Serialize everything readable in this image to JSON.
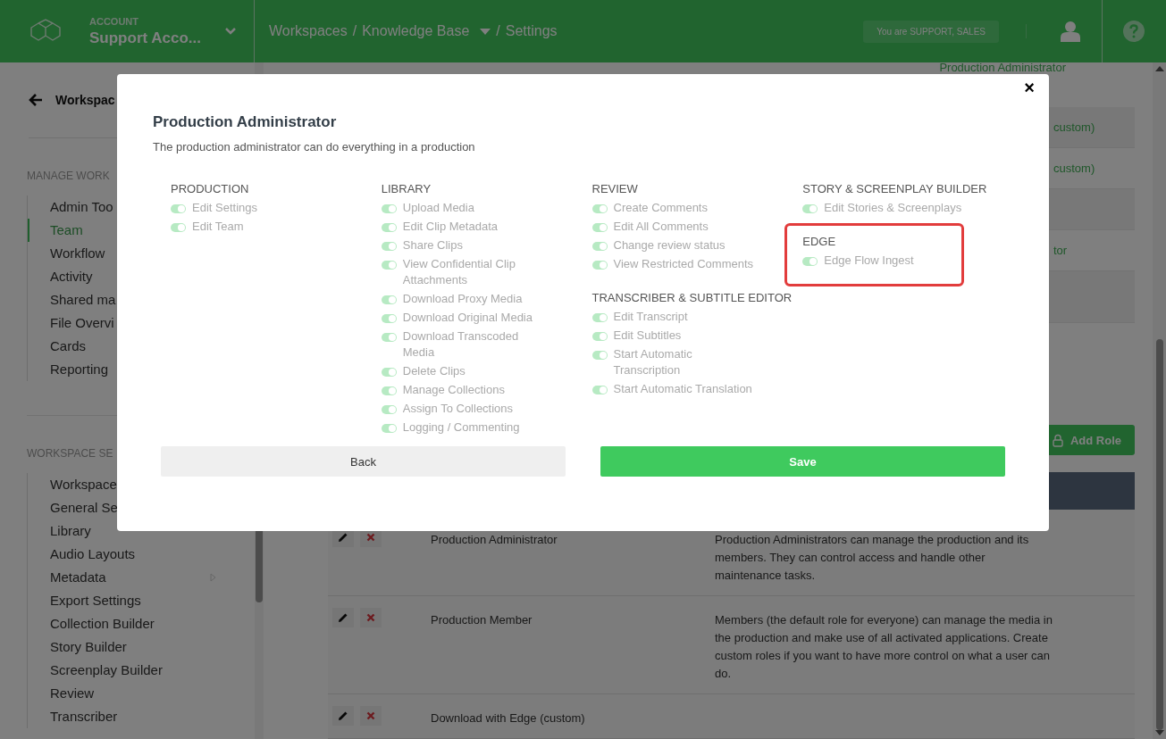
{
  "header": {
    "account_label": "ACCOUNT",
    "account_name": "Support Acco...",
    "breadcrumbs": [
      {
        "label": "Workspaces",
        "dropdown": false
      },
      {
        "label": "Knowledge Base",
        "dropdown": true
      },
      {
        "label": "Settings",
        "dropdown": false
      }
    ],
    "separator": "/",
    "role_badge": "You are SUPPORT, SALES"
  },
  "sidebar": {
    "back_label": "Workspac",
    "sections": [
      {
        "title": "MANAGE WORK",
        "items": [
          {
            "label": "Admin Too",
            "selected": false
          },
          {
            "label": "Team",
            "selected": true
          },
          {
            "label": "Workflow",
            "selected": false
          },
          {
            "label": "Activity",
            "selected": false
          },
          {
            "label": "Shared ma",
            "selected": false
          },
          {
            "label": "File Overvi",
            "selected": false
          },
          {
            "label": "Cards",
            "selected": false
          },
          {
            "label": "Reporting",
            "selected": false
          }
        ]
      },
      {
        "title": "WORKSPACE SE",
        "items": [
          {
            "label": "Workspace",
            "selected": false
          },
          {
            "label": "General Se",
            "selected": false
          },
          {
            "label": "Library",
            "selected": false
          },
          {
            "label": "Audio Layouts",
            "selected": false
          },
          {
            "label": "Metadata",
            "selected": false,
            "submenu": true
          },
          {
            "label": "Export Settings",
            "selected": false
          },
          {
            "label": "Collection Builder",
            "selected": false
          },
          {
            "label": "Story Builder",
            "selected": false
          },
          {
            "label": "Screenplay Builder",
            "selected": false
          },
          {
            "label": "Review",
            "selected": false
          },
          {
            "label": "Transcriber",
            "selected": false
          }
        ]
      }
    ]
  },
  "main": {
    "top_fragment": "Production Administrator",
    "role_rows": [
      {
        "fragment": "custom)"
      },
      {
        "fragment": "custom)"
      },
      {},
      {
        "fragment": "tor"
      },
      {}
    ],
    "add_role_button": "Add Role",
    "table_rows": [
      {
        "name": "Production Administrator",
        "description": "Production Administrators can manage the production and its members. They can control access and handle other maintenance tasks."
      },
      {
        "name": "Production Member",
        "description": "Members (the default role for everyone) can manage the media in the production and make use of all activated applications. Create custom roles if you want to have more control on what a user can do."
      },
      {
        "name": "Download with Edge (custom)"
      }
    ]
  },
  "modal": {
    "close": "×",
    "title": "Production Administrator",
    "description": "The production administrator can do everything in a production",
    "columns": [
      [
        {
          "title": "PRODUCTION",
          "highlighted": false,
          "permissions": [
            {
              "label": "Edit Settings",
              "on": true
            },
            {
              "label": "Edit Team",
              "on": true
            }
          ]
        }
      ],
      [
        {
          "title": "LIBRARY",
          "highlighted": false,
          "permissions": [
            {
              "label": "Upload Media",
              "on": true
            },
            {
              "label": "Edit Clip Metadata",
              "on": true
            },
            {
              "label": "Share Clips",
              "on": true
            },
            {
              "label": "View Confidential Clip Attachments",
              "on": true
            },
            {
              "label": "Download Proxy Media",
              "on": true
            },
            {
              "label": "Download Original Media",
              "on": true
            },
            {
              "label": "Download Transcoded Media",
              "on": true
            },
            {
              "label": "Delete Clips",
              "on": true
            },
            {
              "label": "Manage Collections",
              "on": true
            },
            {
              "label": "Assign To Collections",
              "on": true
            },
            {
              "label": "Logging / Commenting",
              "on": true
            }
          ]
        }
      ],
      [
        {
          "title": "REVIEW",
          "highlighted": false,
          "permissions": [
            {
              "label": "Create Comments",
              "on": true
            },
            {
              "label": "Edit All Comments",
              "on": true
            },
            {
              "label": "Change review status",
              "on": true
            },
            {
              "label": "View Restricted Comments",
              "on": true
            }
          ]
        },
        {
          "title": "TRANSCRIBER & SUBTITLE EDITOR",
          "highlighted": false,
          "permissions": [
            {
              "label": "Edit Transcript",
              "on": true
            },
            {
              "label": "Edit Subtitles",
              "on": true
            },
            {
              "label": "Start Automatic Transcription",
              "on": true
            },
            {
              "label": "Start Automatic Translation",
              "on": true
            }
          ]
        }
      ],
      [
        {
          "title": "STORY & SCREENPLAY BUILDER",
          "highlighted": false,
          "permissions": [
            {
              "label": "Edit Stories & Screenplays",
              "on": true
            }
          ]
        },
        {
          "title": "EDGE",
          "highlighted": true,
          "permissions": [
            {
              "label": "Edge Flow Ingest",
              "on": true
            }
          ]
        }
      ]
    ],
    "back_button": "Back",
    "save_button": "Save"
  }
}
